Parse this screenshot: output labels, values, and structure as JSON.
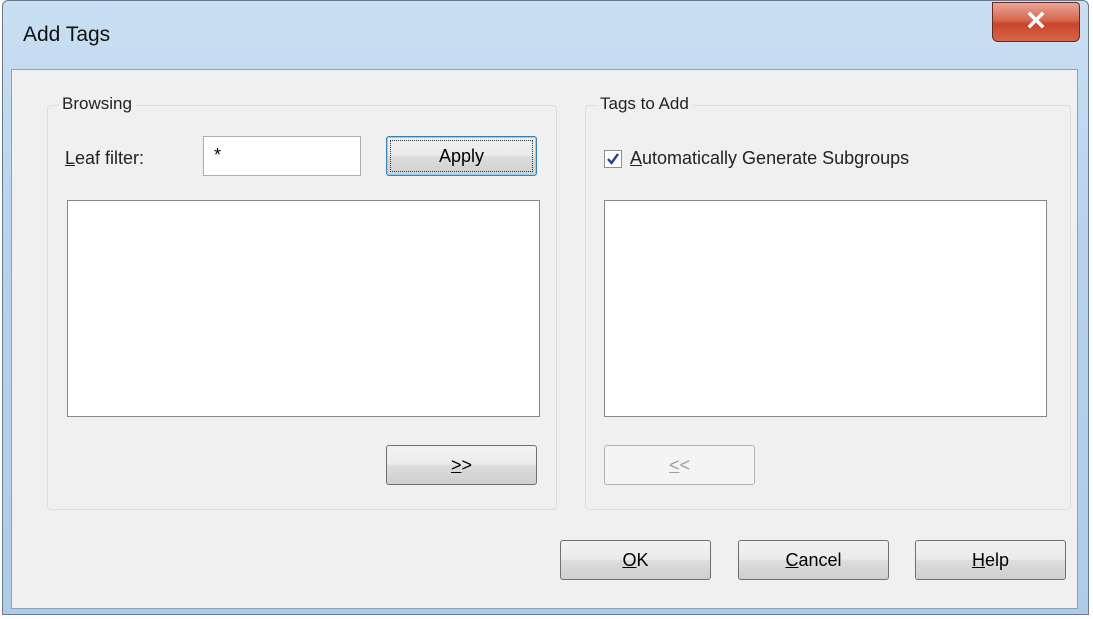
{
  "window": {
    "title": "Add Tags"
  },
  "browsing": {
    "group_title": "Browsing",
    "leaf_filter_label_ul": "L",
    "leaf_filter_label_rest": "eaf filter:",
    "leaf_filter_value": "*",
    "apply_label": "Apply",
    "add_label_ul": ">",
    "add_label_rest": ">"
  },
  "tags_to_add": {
    "group_title": "Tags to Add",
    "auto_subgroups_checked": true,
    "auto_subgroups_label_ul": "A",
    "auto_subgroups_label_rest": "utomatically Generate Subgroups",
    "remove_label_ul": "<",
    "remove_label_rest": "<"
  },
  "footer": {
    "ok_ul": "O",
    "ok_rest": "K",
    "cancel_ul": "C",
    "cancel_rest": "ancel",
    "help_ul": "H",
    "help_rest": "elp"
  },
  "icons": {
    "close": "close-x-icon",
    "check": "checkmark-icon"
  }
}
